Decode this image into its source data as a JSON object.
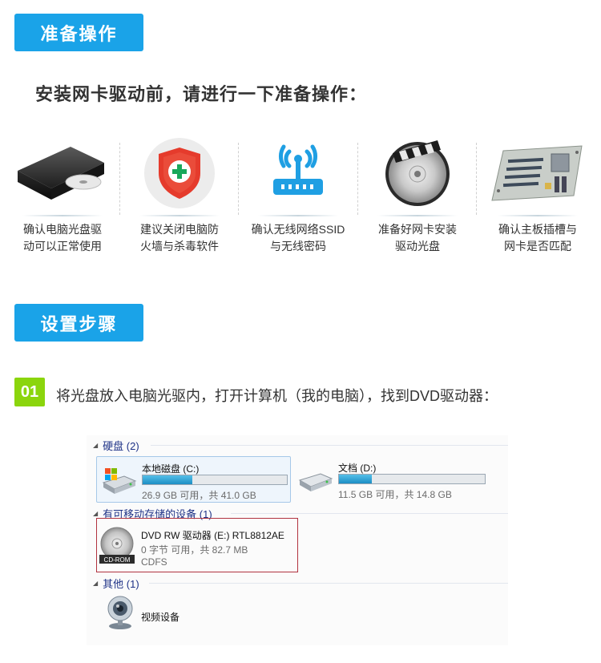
{
  "prep": {
    "tag_label": "准备操作",
    "heading": "安装网卡驱动前，请进行一下准备操作：",
    "items": [
      {
        "icon": "optical-drive-icon",
        "line1": "确认电脑光盘驱",
        "line2": "动可以正常使用"
      },
      {
        "icon": "security-shield-icon",
        "line1": "建议关闭电脑防",
        "line2": "火墙与杀毒软件"
      },
      {
        "icon": "wireless-router-icon",
        "line1": "确认无线网络SSID",
        "line2": "与无线密码"
      },
      {
        "icon": "driver-disc-icon",
        "line1": "准备好网卡安装",
        "line2": "驱动光盘"
      },
      {
        "icon": "motherboard-icon",
        "line1": "确认主板插槽与",
        "line2": "网卡是否匹配"
      }
    ]
  },
  "steps": {
    "tag_label": "设置步骤",
    "step1": {
      "number": "01",
      "text": "将光盘放入电脑光驱内，打开计算机（我的电脑），找到DVD驱动器："
    }
  },
  "explorer": {
    "groups": {
      "hard_disks": "硬盘 (2)",
      "removable": "有可移动存储的设备 (1)",
      "other": "其他 (1)"
    },
    "drives": [
      {
        "name": "本地磁盘 (C:)",
        "free_text": "26.9 GB 可用，共 41.0 GB",
        "used_fraction": 0.344
      },
      {
        "name": "文档 (D:)",
        "free_text": "11.5 GB 可用，共 14.8 GB",
        "used_fraction": 0.223
      }
    ],
    "dvd": {
      "name": "DVD RW 驱动器 (E:) RTL8812AE",
      "space": "0 字节 可用，共 82.7 MB",
      "filesystem": "CDFS",
      "badge": "CD-ROM"
    },
    "camera": {
      "name": "视频设备"
    }
  },
  "colors": {
    "accent_blue": "#1aa3e8",
    "step_green": "#8bd50d",
    "group_text": "#1e3287",
    "highlight_red": "#b13340",
    "shield_red": "#e53b2c",
    "wireless_blue": "#1f9fe3"
  }
}
